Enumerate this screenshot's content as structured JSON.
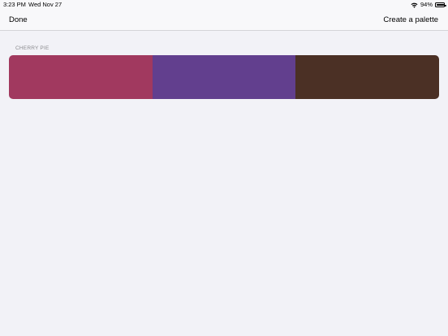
{
  "status_bar": {
    "time": "3:23 PM",
    "date": "Wed Nov 27",
    "battery_percent": "94%",
    "battery_level": 0.94,
    "wifi_icon": "wifi-icon",
    "battery_icon": "battery-icon"
  },
  "nav_bar": {
    "done_label": "Done",
    "create_label": "Create a palette"
  },
  "palettes": [
    {
      "name": "CHERRY PIE",
      "colors": [
        "#a1395f",
        "#623f8e",
        "#4b3025"
      ]
    }
  ],
  "colors": {
    "background": "#f2f2f7",
    "bar_background": "#f8f8fa",
    "section_header": "#8a8a8e"
  }
}
